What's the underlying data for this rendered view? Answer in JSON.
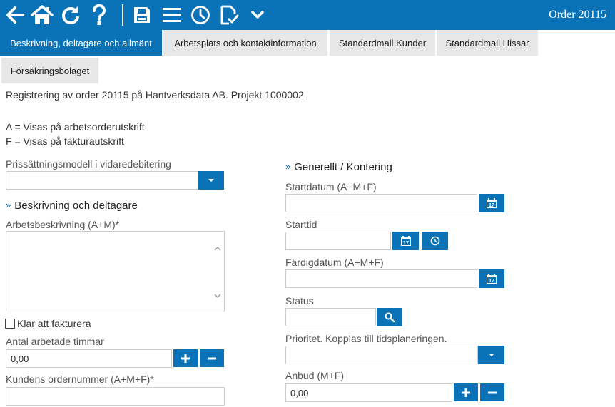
{
  "toolbar": {
    "icons": [
      "back-arrow-icon",
      "home-icon",
      "refresh-icon",
      "help-icon",
      "save-icon",
      "menu-icon",
      "clock-icon",
      "document-check-icon",
      "chevron-down-icon"
    ],
    "title": "Order 20115"
  },
  "tabs": [
    {
      "label": "Beskrivning, deltagare och allmänt",
      "active": true
    },
    {
      "label": "Arbetsplats och kontaktinformation",
      "active": false
    },
    {
      "label": "Standardmall Kunder",
      "active": false
    },
    {
      "label": "Standardmall Hissar",
      "active": false
    },
    {
      "label": "Försäkringsbolaget",
      "active": false
    }
  ],
  "intro": {
    "registration": "Registrering av order 20115 på Hantverksdata AB. Projekt 1000002.",
    "legend_a": "A = Visas på arbetsorderutskrift",
    "legend_f": "F = Visas på fakturautskrift"
  },
  "left": {
    "pricing_label": "Prissättningsmodell i vidaredebitering",
    "pricing_value": "",
    "section_title": "Beskrivning och deltagare",
    "description_label": "Arbetsbeskrivning (A+M)*",
    "description_value": "",
    "ready_label": "Klar att fakturera",
    "ready_checked": false,
    "hours_label": "Antal arbetade timmar",
    "hours_value": "0,00",
    "customer_order_label": "Kundens ordernummer (A+M+F)*",
    "customer_order_value": ""
  },
  "right": {
    "section_title": "Generellt / Kontering",
    "start_date_label": "Startdatum (A+M+F)",
    "start_date_value": "",
    "start_time_label": "Starttid",
    "start_time_value": "",
    "finish_date_label": "Färdigdatum (A+M+F)",
    "finish_date_value": "",
    "status_label": "Status",
    "status_value": "",
    "priority_label": "Prioritet. Kopplas till tidsplaneringen.",
    "priority_value": "",
    "bid_label": "Anbud (M+F)",
    "bid_value": "0,00"
  },
  "colors": {
    "accent": "#0a73b7",
    "tab_inactive": "#e7e7e7"
  }
}
